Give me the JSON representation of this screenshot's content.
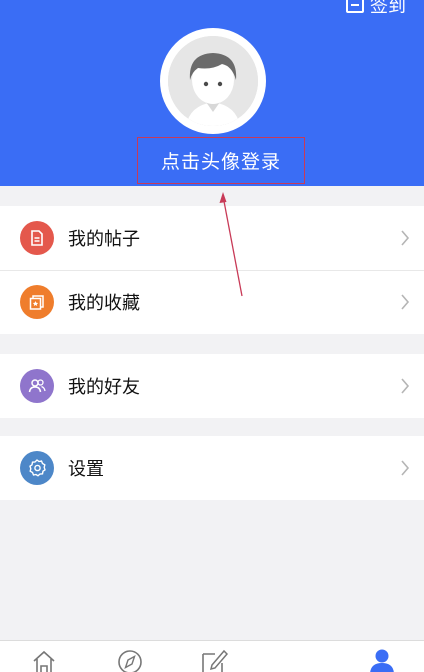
{
  "header": {
    "checkin_label": "签到",
    "login_prompt": "点击头像登录"
  },
  "menu": {
    "posts": "我的帖子",
    "favorites": "我的收藏",
    "friends": "我的好友",
    "settings": "设置"
  },
  "colors": {
    "header_bg": "#3a6df5",
    "posts_icon": "#e4584c",
    "favorites_icon": "#ef7d2c",
    "friends_icon": "#8f75cc",
    "settings_icon": "#4d87c8",
    "tab_active": "#3a6df5"
  },
  "tabbar": {
    "items": [
      "home-icon",
      "compass-icon",
      "edit-icon",
      "profile-icon"
    ],
    "active_index": 3
  }
}
